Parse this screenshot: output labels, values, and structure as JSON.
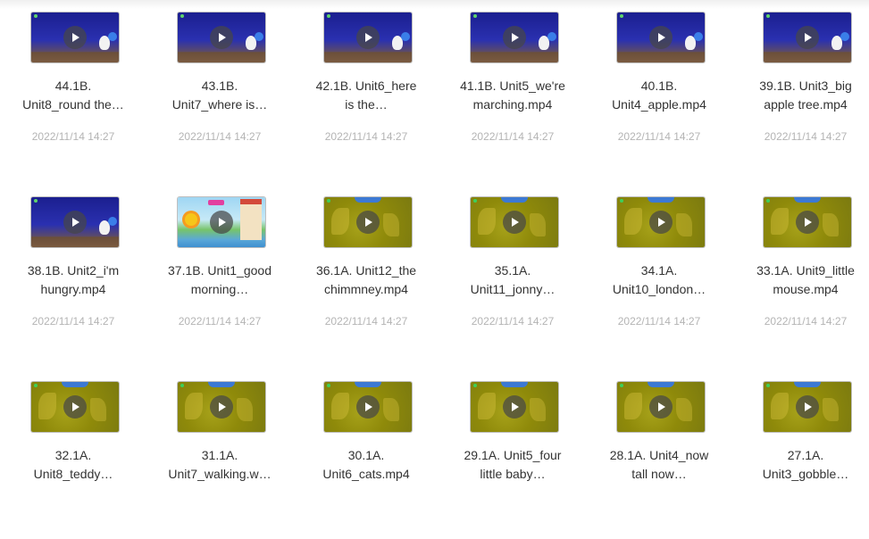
{
  "files": [
    {
      "line1": "44.1B.",
      "line2": "Unit8_round the…",
      "date": "2022/11/14 14:27",
      "thumb": "night"
    },
    {
      "line1": "43.1B.",
      "line2": "Unit7_where is…",
      "date": "2022/11/14 14:27",
      "thumb": "night"
    },
    {
      "line1": "42.1B. Unit6_here",
      "line2": "is the…",
      "date": "2022/11/14 14:27",
      "thumb": "night"
    },
    {
      "line1": "41.1B. Unit5_we're",
      "line2": "marching.mp4",
      "date": "2022/11/14 14:27",
      "thumb": "night"
    },
    {
      "line1": "40.1B.",
      "line2": "Unit4_apple.mp4",
      "date": "2022/11/14 14:27",
      "thumb": "night"
    },
    {
      "line1": "39.1B. Unit3_big",
      "line2": "apple tree.mp4",
      "date": "2022/11/14 14:27",
      "thumb": "night"
    },
    {
      "line1": "38.1B. Unit2_i'm",
      "line2": "hungry.mp4",
      "date": "2022/11/14 14:27",
      "thumb": "night"
    },
    {
      "line1": "37.1B. Unit1_good",
      "line2": "morning…",
      "date": "2022/11/14 14:27",
      "thumb": "garden"
    },
    {
      "line1": "36.1A. Unit12_the",
      "line2": "chimmney.mp4",
      "date": "2022/11/14 14:27",
      "thumb": "olive"
    },
    {
      "line1": "35.1A.",
      "line2": "Unit11_jonny…",
      "date": "2022/11/14 14:27",
      "thumb": "olive"
    },
    {
      "line1": "34.1A.",
      "line2": "Unit10_london…",
      "date": "2022/11/14 14:27",
      "thumb": "olive"
    },
    {
      "line1": "33.1A. Unit9_little",
      "line2": "mouse.mp4",
      "date": "2022/11/14 14:27",
      "thumb": "olive"
    },
    {
      "line1": "32.1A.",
      "line2": "Unit8_teddy…",
      "date": "",
      "thumb": "olive"
    },
    {
      "line1": "31.1A.",
      "line2": "Unit7_walking.w…",
      "date": "",
      "thumb": "olive"
    },
    {
      "line1": "30.1A.",
      "line2": "Unit6_cats.mp4",
      "date": "",
      "thumb": "olive"
    },
    {
      "line1": "29.1A. Unit5_four",
      "line2": "little baby…",
      "date": "",
      "thumb": "olive"
    },
    {
      "line1": "28.1A. Unit4_now",
      "line2": "tall now…",
      "date": "",
      "thumb": "olive"
    },
    {
      "line1": "27.1A.",
      "line2": "Unit3_gobble…",
      "date": "",
      "thumb": "olive"
    }
  ]
}
